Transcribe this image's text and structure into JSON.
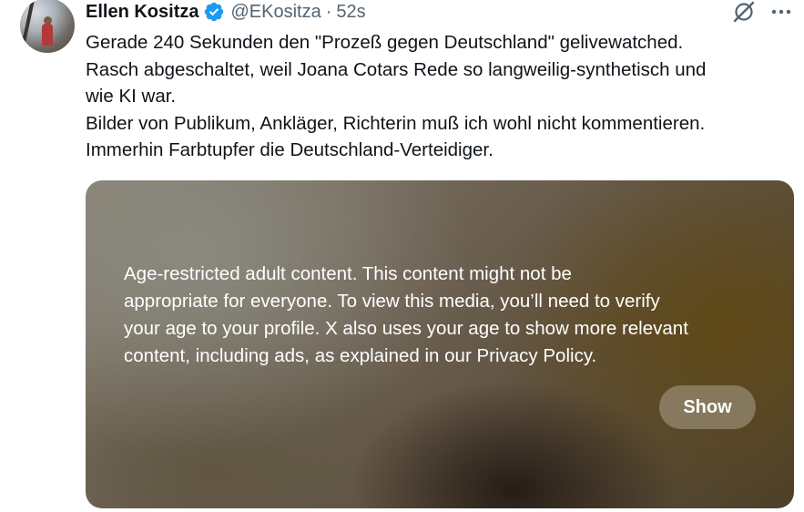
{
  "author": {
    "name": "Ellen Kositza",
    "handle": "@EKositza",
    "separator": "·",
    "time": "52s"
  },
  "tweet": {
    "lines": [
      "Gerade 240 Sekunden den \"Prozeß gegen Deutschland\" gelivewatched.",
      "Rasch abgeschaltet, weil Joana Cotars Rede so langweilig-synthetisch und",
      "wie KI war.",
      "Bilder von Publikum, Ankläger, Richterin muß ich wohl nicht kommentieren.",
      "Immerhin Farbtupfer die Deutschland-Verteidiger."
    ]
  },
  "media": {
    "notice_lines": [
      "Age-restricted adult content. This content might not be",
      "appropriate for everyone. To view this media, you’ll need to verify",
      "your age to your profile. X also uses your age to show more relevant",
      "content, including ads, as explained in our Privacy Policy."
    ],
    "show_label": "Show"
  },
  "icons": {
    "verified": "verified-badge-icon",
    "grok": "grok-icon",
    "more": "more-icon"
  },
  "colors": {
    "verified_blue": "#1d9bf0",
    "secondary_text": "#536471",
    "primary_text": "#0f1419"
  }
}
